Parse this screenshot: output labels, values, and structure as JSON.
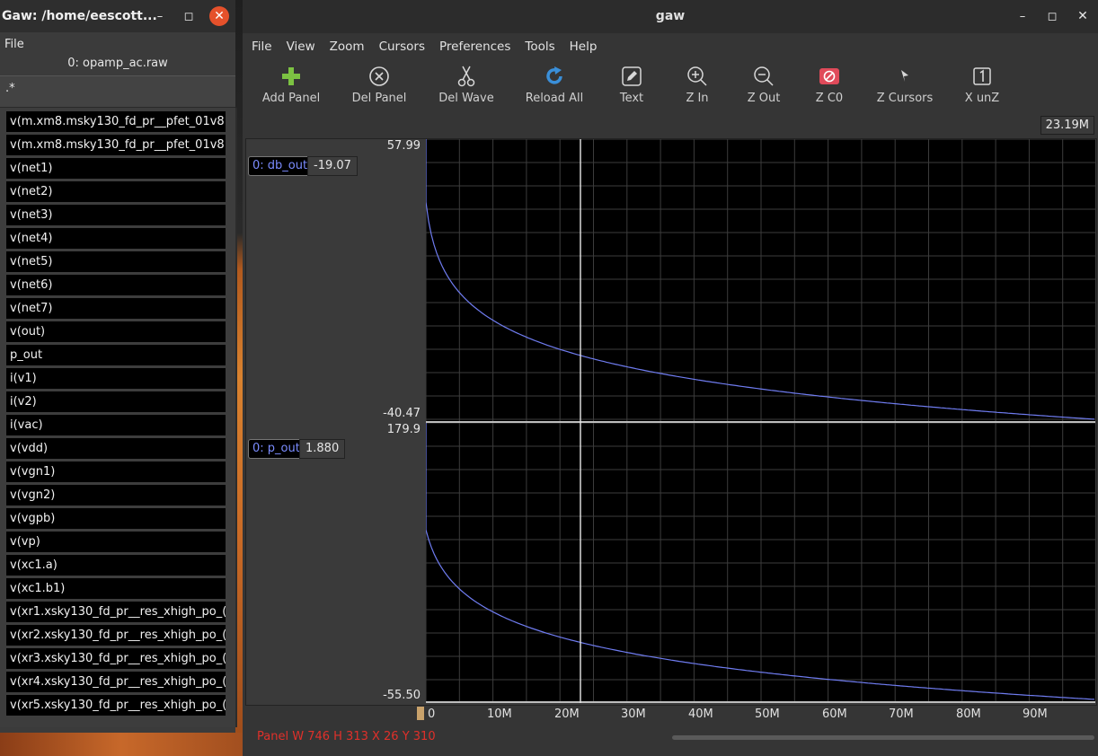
{
  "left_window": {
    "title": "Gaw: /home/eescott...",
    "menu_file": "File",
    "file_label": "0: opamp_ac.raw",
    "filter_value": ".*",
    "signals": [
      "v(m.xm8.msky130_fd_pr__pfet_01v8",
      "v(m.xm8.msky130_fd_pr__pfet_01v8",
      "v(net1)",
      "v(net2)",
      "v(net3)",
      "v(net4)",
      "v(net5)",
      "v(net6)",
      "v(net7)",
      "v(out)",
      "p_out",
      "i(v1)",
      "i(v2)",
      "i(vac)",
      "v(vdd)",
      "v(vgn1)",
      "v(vgn2)",
      "v(vgpb)",
      "v(vp)",
      "v(xc1.a)",
      "v(xc1.b1)",
      "v(xr1.xsky130_fd_pr__res_xhigh_po_(",
      "v(xr2.xsky130_fd_pr__res_xhigh_po_(",
      "v(xr3.xsky130_fd_pr__res_xhigh_po_(",
      "v(xr4.xsky130_fd_pr__res_xhigh_po_(",
      "v(xr5.xsky130_fd_pr__res_xhigh_po_("
    ]
  },
  "main_window": {
    "title": "gaw",
    "menu": [
      "File",
      "View",
      "Zoom",
      "Cursors",
      "Preferences",
      "Tools",
      "Help"
    ],
    "toolbar": [
      {
        "label": "Add Panel",
        "icon": "plus-icon"
      },
      {
        "label": "Del Panel",
        "icon": "circle-x-icon"
      },
      {
        "label": "Del Wave",
        "icon": "scissors-icon"
      },
      {
        "label": "Reload All",
        "icon": "reload-icon"
      },
      {
        "label": "Text",
        "icon": "pencil-icon"
      },
      {
        "label": "Z In",
        "icon": "zoom-in-icon"
      },
      {
        "label": "Z Out",
        "icon": "zoom-out-icon"
      },
      {
        "label": "Z C0",
        "icon": "no-entry-icon"
      },
      {
        "label": "Z Cursors",
        "icon": "cursor-icon"
      },
      {
        "label": "X unZ",
        "icon": "one-box-icon"
      }
    ],
    "cursor_readout": "23.19M",
    "panels": [
      {
        "wave": "0: db_out",
        "value": "-19.07",
        "ymax": "57.99",
        "ymin": "-40.47"
      },
      {
        "wave": "0: p_out",
        "value": "1.880",
        "ymax": "179.9",
        "ymin": "-55.50"
      }
    ],
    "x_ticks": [
      "0",
      "10M",
      "20M",
      "30M",
      "40M",
      "50M",
      "60M",
      "70M",
      "80M",
      "90M"
    ],
    "status": "Panel W 746 H 313 X 26 Y 310"
  },
  "colors": {
    "wave": "#6f7cf0",
    "close": "#e5512b",
    "status": "#e0302a"
  }
}
